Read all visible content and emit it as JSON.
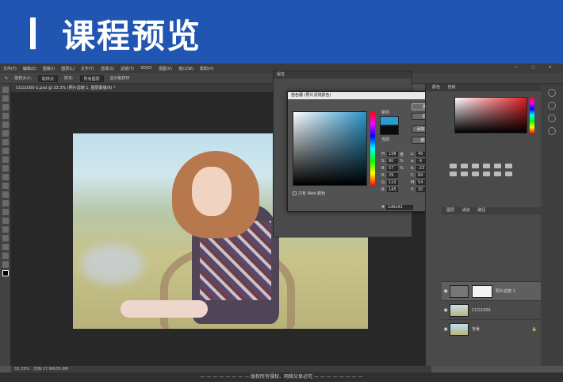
{
  "banner": {
    "title": "课程预览"
  },
  "menubar": {
    "items": [
      "文件(F)",
      "编辑(E)",
      "图像(I)",
      "图层(L)",
      "文字(Y)",
      "选择(S)",
      "滤镜(T)",
      "3D(D)",
      "视图(V)",
      "窗口(W)",
      "帮助(H)"
    ],
    "window_controls": [
      "—",
      "▢",
      "✕"
    ]
  },
  "options_bar": {
    "sample_size_label": "取样大小:",
    "sample_size_value": "取样点",
    "sample_label": "样本:",
    "sample_value": "所有图层",
    "show_ring_label": "显示取样环"
  },
  "document_tab": {
    "label": "CCG1000-1.psd @ 33.3% (照片滤镜 1, 图层蒙版/8) *"
  },
  "status_bar": {
    "zoom": "33.33%",
    "doc_size": "文档:17.9M/35.8M"
  },
  "footer": {
    "text": "— — — — — — — — 版权所有侵权、网络分享必究 — — — — — — — —"
  },
  "back_panel": {
    "title": "属性"
  },
  "color_picker": {
    "title": "拾色器 (照片滤镜颜色)",
    "close": "✕",
    "new_label": "新的",
    "current_label": "当前",
    "buttons": {
      "ok": "确定",
      "cancel": "取消",
      "add_swatch": "添加到色板",
      "libraries": "颜色库"
    },
    "web_only_label": "只有 Web 颜色",
    "fields_left": [
      {
        "label": "H:",
        "value": "198",
        "unit": "度"
      },
      {
        "label": "S:",
        "value": "80",
        "unit": "%"
      },
      {
        "label": "B:",
        "value": "57",
        "unit": "%"
      },
      {
        "label": "R:",
        "value": "29",
        "unit": ""
      },
      {
        "label": "G:",
        "value": "110",
        "unit": ""
      },
      {
        "label": "B:",
        "value": "145",
        "unit": ""
      }
    ],
    "fields_right": [
      {
        "label": "L:",
        "value": "45",
        "unit": ""
      },
      {
        "label": "a:",
        "value": "-9",
        "unit": ""
      },
      {
        "label": "b:",
        "value": "-23",
        "unit": ""
      },
      {
        "label": "C:",
        "value": "84",
        "unit": "%"
      },
      {
        "label": "M:",
        "value": "54",
        "unit": "%"
      },
      {
        "label": "Y:",
        "value": "30",
        "unit": "%"
      }
    ],
    "hex_label": "#",
    "hex_value": "1d6e91",
    "new_color": "#2a9ccf",
    "current_color": "#0b0b0b"
  },
  "right_dock": {
    "color_tabs": [
      "颜色",
      "色板"
    ],
    "layers_tabs": [
      "图层",
      "通道",
      "路径"
    ],
    "layers": [
      {
        "name": "照片滤镜 1",
        "type": "adjustment",
        "selected": true
      },
      {
        "name": "CCG1000",
        "type": "image",
        "selected": false
      },
      {
        "name": "背景",
        "type": "image",
        "selected": false
      }
    ]
  },
  "colors": {
    "banner_bg": "#2056b1",
    "ps_bg": "#535353",
    "canvas_bg": "#282828"
  }
}
